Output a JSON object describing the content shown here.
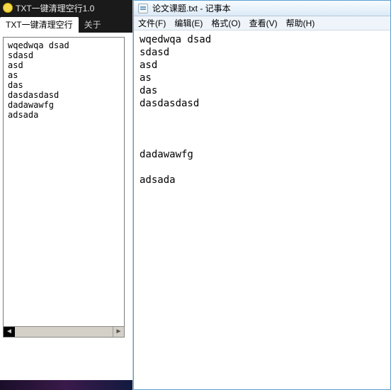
{
  "left": {
    "title": "TXT一键清理空行1.0",
    "tabs": [
      {
        "label": "TXT一键清理空行"
      },
      {
        "label": "关于"
      }
    ],
    "content": "wqedwqa dsad\nsdasd\nasd\nas\ndas\ndasdasdasd\ndadawawfg\nadsada"
  },
  "right": {
    "title": "论文课题.txt - 记事本",
    "menu": {
      "file": "文件(F)",
      "edit": "编辑(E)",
      "format": "格式(O)",
      "view": "查看(V)",
      "help": "帮助(H)"
    },
    "content": "wqedwqa dsad\nsdasd\nasd\nas\ndas\ndasdasdasd\n\n\n\ndadawawfg\n\nadsada"
  }
}
